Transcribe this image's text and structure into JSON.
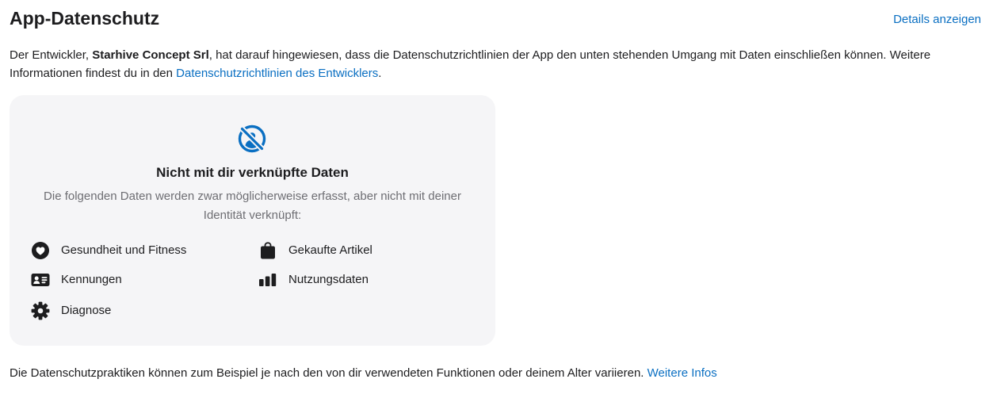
{
  "header": {
    "title": "App-Datenschutz",
    "details_link": "Details anzeigen"
  },
  "intro": {
    "part1": "Der Entwickler, ",
    "developer": "Starhive Concept Srl",
    "part2": ", hat darauf hingewiesen, dass die Datenschutzrichtlinien der App den unten stehenden Umgang mit Daten einschließen können. Weitere Informationen findest du in den ",
    "policy_link": "Datenschutzrichtlinien des Entwicklers",
    "part3": "."
  },
  "card": {
    "icon": "not-linked-icon",
    "title": "Nicht mit dir verknüpfte Daten",
    "description": "Die folgenden Daten werden zwar möglicherweise erfasst, aber nicht mit deiner Identität verknüpft:",
    "items": [
      {
        "label": "Gesundheit und Fitness",
        "icon": "heart-icon"
      },
      {
        "label": "Gekaufte Artikel",
        "icon": "shopping-bag-icon"
      },
      {
        "label": "Kennungen",
        "icon": "id-card-icon"
      },
      {
        "label": "Nutzungsdaten",
        "icon": "bar-chart-icon"
      },
      {
        "label": "Diagnose",
        "icon": "gear-icon"
      }
    ]
  },
  "footer": {
    "text": "Die Datenschutzpraktiken können zum Beispiel je nach den von dir verwendeten Funktionen oder deinem Alter variieren. ",
    "link": "Weitere Infos"
  },
  "colors": {
    "accent": "#0a6fc2",
    "card_background": "#f5f5f7",
    "secondary_text": "#6e6e73"
  }
}
